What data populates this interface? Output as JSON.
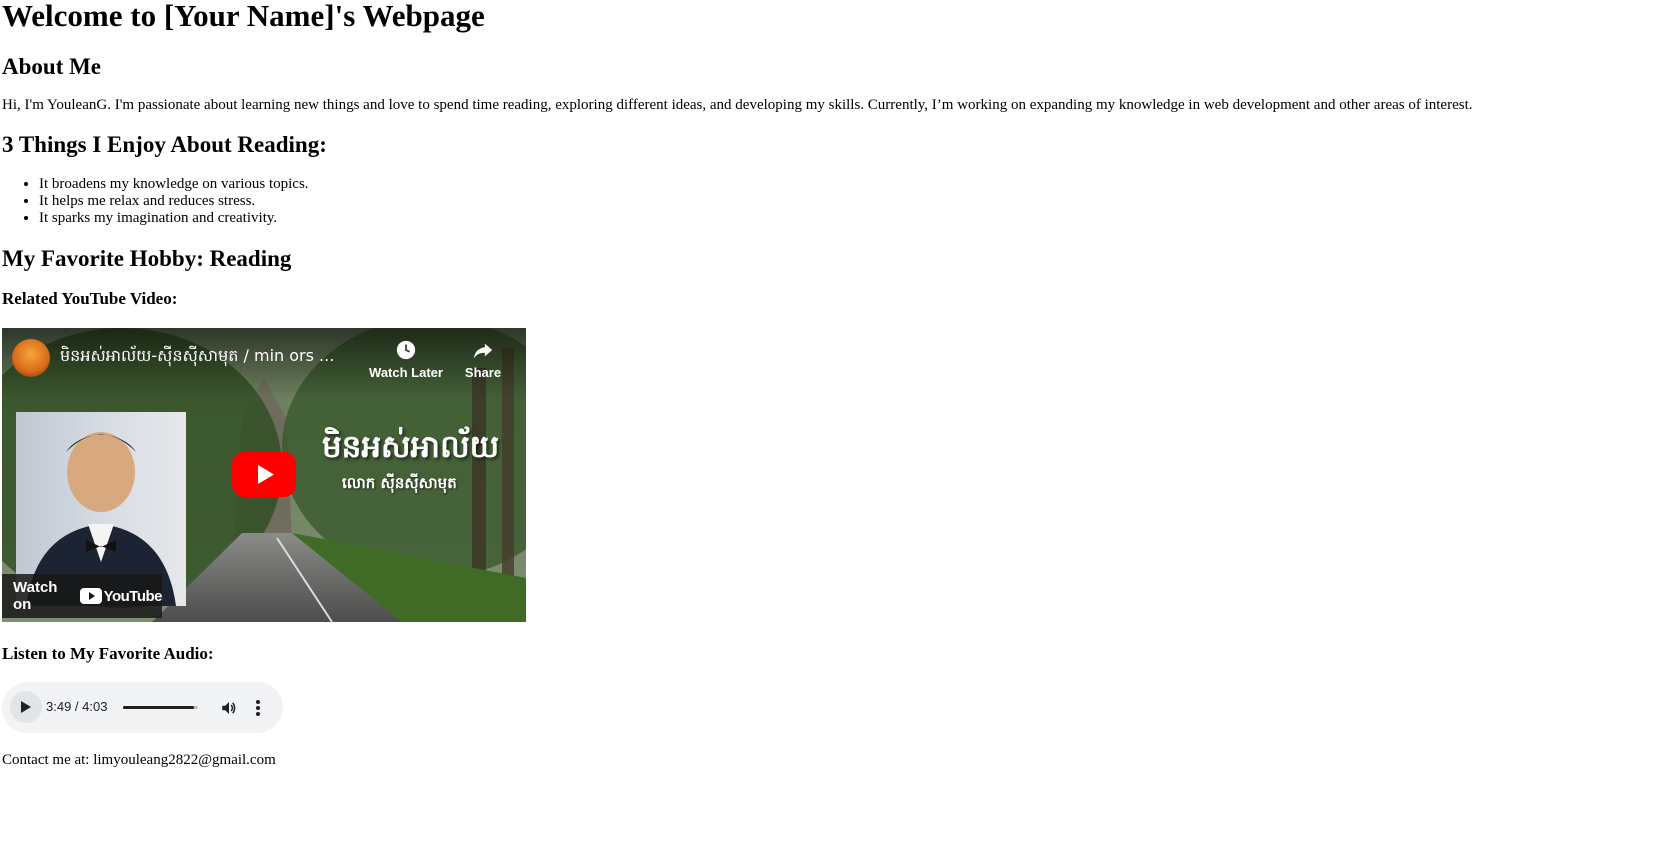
{
  "header": {
    "title": "Welcome to [Your Name]'s Webpage"
  },
  "about": {
    "heading": "About Me",
    "text": "Hi, I'm YouleanG. I'm passionate about learning new things and love to spend time reading, exploring different ideas, and developing my skills. Currently, I’m working on expanding my knowledge in web development and other areas of interest."
  },
  "reading": {
    "heading": "3 Things I Enjoy About Reading:",
    "items": [
      "It broadens my knowledge on various topics.",
      "It helps me relax and reduces stress.",
      "It sparks my imagination and creativity."
    ]
  },
  "hobby": {
    "heading": "My Favorite Hobby: Reading"
  },
  "video": {
    "heading": "Related YouTube Video:",
    "title": "មិនអស់អាល័យ-ស៊ីនស៊ីសាមុត / min ors ...",
    "watch_later": "Watch Later",
    "share": "Share",
    "thumb_title": "មិនអស់អាល័យ",
    "thumb_subtitle": "លោក  ស៊ីនស៊ីសាមុត",
    "watch_on": "Watch on",
    "youtube": "YouTube"
  },
  "audio": {
    "heading": "Listen to My Favorite Audio:",
    "time": "3:49 / 4:03",
    "progress": 0.94
  },
  "contact": {
    "text": "Contact me at: limyouleang2822@gmail.com"
  },
  "colors": {
    "youtube_red": "#ff0000",
    "audio_bg": "#f1f3f4"
  },
  "icons": [
    "clock-icon",
    "share-icon",
    "youtube-play-icon",
    "play-icon",
    "volume-icon",
    "more-vert-icon"
  ]
}
